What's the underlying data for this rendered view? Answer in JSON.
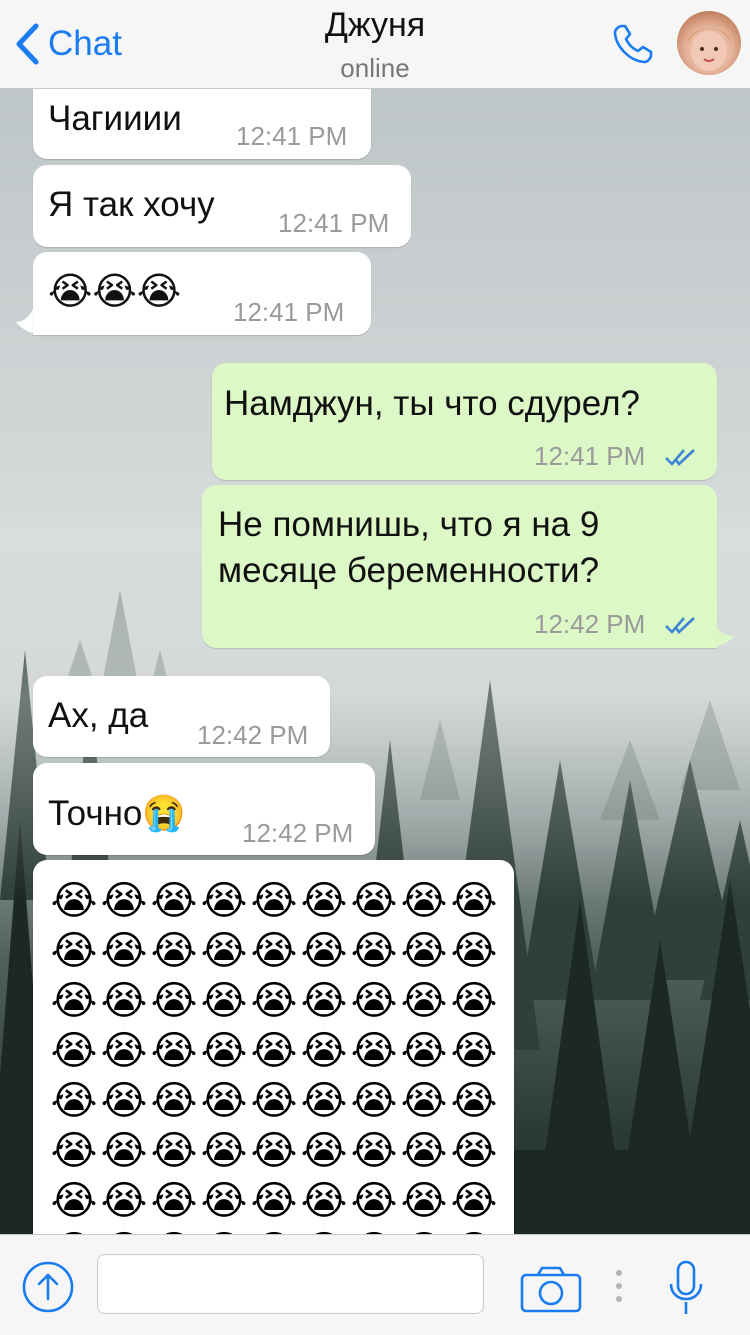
{
  "header": {
    "back_label": "Chat",
    "contact_name": "Джуня",
    "status": "online"
  },
  "messages": [
    {
      "side": "in",
      "text": "Чагииии",
      "time": "12:41 PM"
    },
    {
      "side": "in",
      "text": "Я так хочу",
      "time": "12:41 PM"
    },
    {
      "side": "in",
      "text": "😭😭😭",
      "time": "12:41 PM"
    },
    {
      "side": "out",
      "text": "Намджун, ты что сдурел?",
      "time": "12:41 PM",
      "read": true
    },
    {
      "side": "out",
      "text_line1": "Не помнишь, что я на 9",
      "text_line2": "месяце беременности?",
      "time": "12:42 PM",
      "read": true
    },
    {
      "side": "in",
      "text": "Ах, да",
      "time": "12:42 PM"
    },
    {
      "side": "in",
      "text": "Точно😭",
      "time": "12:42 PM"
    },
    {
      "side": "in",
      "emoji": "😭",
      "rows_visible": 7,
      "per_row": 9
    }
  ],
  "composer": {
    "placeholder": ""
  },
  "icons": {
    "back": "chevron-left-icon",
    "call": "phone-icon",
    "share": "upload-arrow-icon",
    "camera": "camera-icon",
    "mic": "microphone-icon",
    "read_receipt": "double-check-icon"
  },
  "colors": {
    "accent": "#1a7cf0",
    "incoming_bubble": "#ffffff",
    "outgoing_bubble": "#dcf8c6",
    "timestamp": "#9a9a9a"
  }
}
